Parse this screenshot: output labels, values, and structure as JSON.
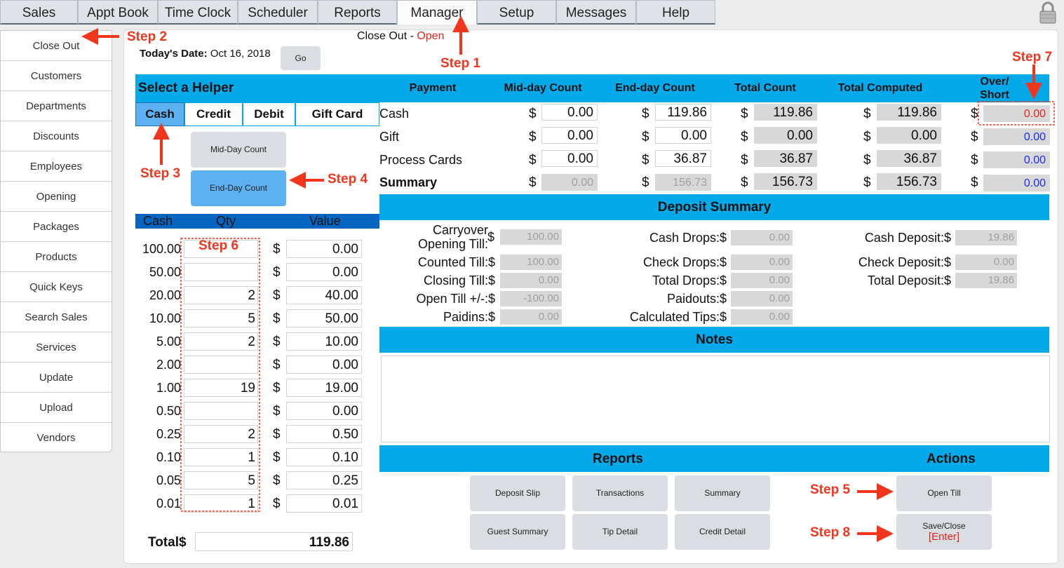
{
  "tabs": [
    "Sales",
    "Appt Book",
    "Time Clock",
    "Scheduler",
    "Reports",
    "Manager",
    "Setup",
    "Messages",
    "Help"
  ],
  "active_tab": "Manager",
  "sidebar": {
    "items": [
      "Close Out",
      "Customers",
      "Departments",
      "Discounts",
      "Employees",
      "Opening",
      "Packages",
      "Products",
      "Quick Keys",
      "Search Sales",
      "Services",
      "Update",
      "Upload",
      "Vendors"
    ]
  },
  "header": {
    "title_prefix": "Close Out - ",
    "status": "Open",
    "date_label": "Today's Date:",
    "date_value": "Oct 16, 2018",
    "go_label": "Go"
  },
  "helper": {
    "title": "Select a Helper",
    "tabs": [
      "Cash",
      "Credit",
      "Debit",
      "Gift Card"
    ],
    "mid_day_btn": "Mid-Day Count",
    "end_day_btn": "End-Day Count"
  },
  "cash_table": {
    "headers": [
      "Cash",
      "Qty",
      "Value"
    ],
    "rows": [
      {
        "denom": "100.00",
        "qty": "",
        "value": "0.00"
      },
      {
        "denom": "50.00",
        "qty": "",
        "value": "0.00"
      },
      {
        "denom": "20.00",
        "qty": "2",
        "value": "40.00"
      },
      {
        "denom": "10.00",
        "qty": "5",
        "value": "50.00"
      },
      {
        "denom": "5.00",
        "qty": "2",
        "value": "10.00"
      },
      {
        "denom": "2.00",
        "qty": "",
        "value": "0.00"
      },
      {
        "denom": "1.00",
        "qty": "19",
        "value": "19.00"
      },
      {
        "denom": "0.50",
        "qty": "",
        "value": "0.00"
      },
      {
        "denom": "0.25",
        "qty": "2",
        "value": "0.50"
      },
      {
        "denom": "0.10",
        "qty": "1",
        "value": "0.10"
      },
      {
        "denom": "0.05",
        "qty": "5",
        "value": "0.25"
      },
      {
        "denom": "0.01",
        "qty": "1",
        "value": "0.01"
      }
    ],
    "currency": "$",
    "total_label": "Total$",
    "total_value": "119.86"
  },
  "payment_table": {
    "headers": [
      "Payment",
      "Mid-day Count",
      "End-day Count",
      "Total Count",
      "Total Computed",
      "Over/ Short"
    ],
    "rows": [
      {
        "label": "Cash",
        "mid": "0.00",
        "end": "119.86",
        "total": "119.86",
        "computed": "119.86",
        "over": "0.00"
      },
      {
        "label": "Gift",
        "mid": "0.00",
        "end": "0.00",
        "total": "0.00",
        "computed": "0.00",
        "over": "0.00"
      },
      {
        "label": "Process Cards",
        "mid": "0.00",
        "end": "36.87",
        "total": "36.87",
        "computed": "36.87",
        "over": "0.00"
      },
      {
        "label": "Summary",
        "mid": "0.00",
        "end": "156.73",
        "total": "156.73",
        "computed": "156.73",
        "over": "0.00"
      }
    ]
  },
  "deposit_summary": {
    "title": "Deposit Summary",
    "col1": [
      {
        "label": "Carryover Opening Till:",
        "value": "100.00"
      },
      {
        "label": "Counted Till:$",
        "value": "100.00"
      },
      {
        "label": "Closing Till:$",
        "value": "0.00"
      },
      {
        "label": "Open Till +/-:$",
        "value": "-100.00"
      },
      {
        "label": "Paidins:$",
        "value": "0.00"
      }
    ],
    "col2": [
      {
        "label": "Cash Drops:$",
        "value": "0.00"
      },
      {
        "label": "Check Drops:$",
        "value": "0.00"
      },
      {
        "label": "Total Drops:$",
        "value": "0.00"
      },
      {
        "label": "Paidouts:$",
        "value": "0.00"
      },
      {
        "label": "Calculated Tips:$",
        "value": "0.00"
      }
    ],
    "col3": [
      {
        "label": "Cash Deposit:$",
        "value": "19.86"
      },
      {
        "label": "Check Deposit:$",
        "value": "0.00"
      },
      {
        "label": "Total Deposit:$",
        "value": "19.86"
      }
    ]
  },
  "notes": {
    "title": "Notes",
    "value": ""
  },
  "reports": {
    "title": "Reports",
    "buttons": [
      "Deposit Slip",
      "Transactions",
      "Summary",
      "Guest Summary",
      "Tip Detail",
      "Credit Detail"
    ]
  },
  "actions": {
    "title": "Actions",
    "open_till": "Open Till",
    "save_close": "Save/Close",
    "save_close_key": "[Enter]"
  },
  "steps": {
    "step1": "Step 1",
    "step2": "Step 2",
    "step3": "Step 3",
    "step4": "Step 4",
    "step5": "Step 5",
    "step6": "Step 6",
    "step7": "Step 7",
    "step8": "Step 8"
  },
  "colors": {
    "accent": "#04a9e9",
    "annotation": "#f1361d",
    "selected": "#5eb1f0",
    "status_open": "#e8231b",
    "over_short": "#1b2cf0"
  }
}
